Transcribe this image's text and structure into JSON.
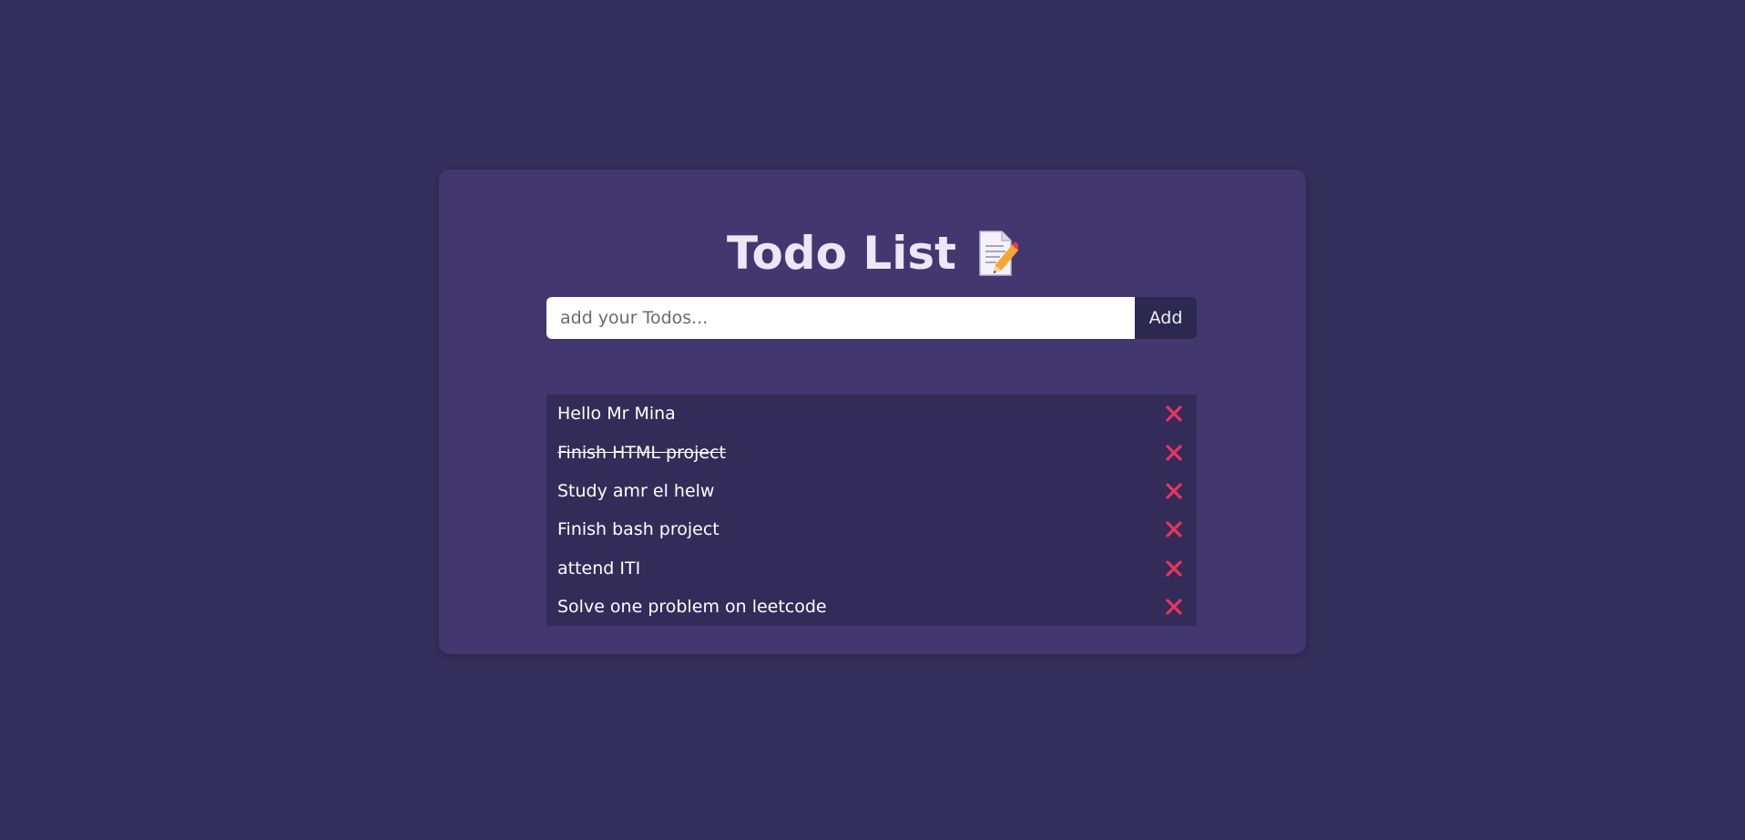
{
  "header": {
    "title": "Todo List",
    "title_icon": "memo-icon"
  },
  "form": {
    "placeholder": "add your Todos...",
    "value": "",
    "add_label": "Add"
  },
  "todos": [
    {
      "text": "Hello Mr Mina",
      "completed": false
    },
    {
      "text": "Finish HTML project",
      "completed": true
    },
    {
      "text": "Study amr el helw",
      "completed": false
    },
    {
      "text": "Finish bash project",
      "completed": false
    },
    {
      "text": "attend ITI",
      "completed": false
    },
    {
      "text": "Solve one problem on leetcode",
      "completed": false
    }
  ],
  "icons": {
    "delete": "close-icon"
  },
  "colors": {
    "background": "#342f5a",
    "card": "#42376f",
    "list": "#342c58",
    "delete": "#e8355e",
    "title": "#ece7f6"
  }
}
